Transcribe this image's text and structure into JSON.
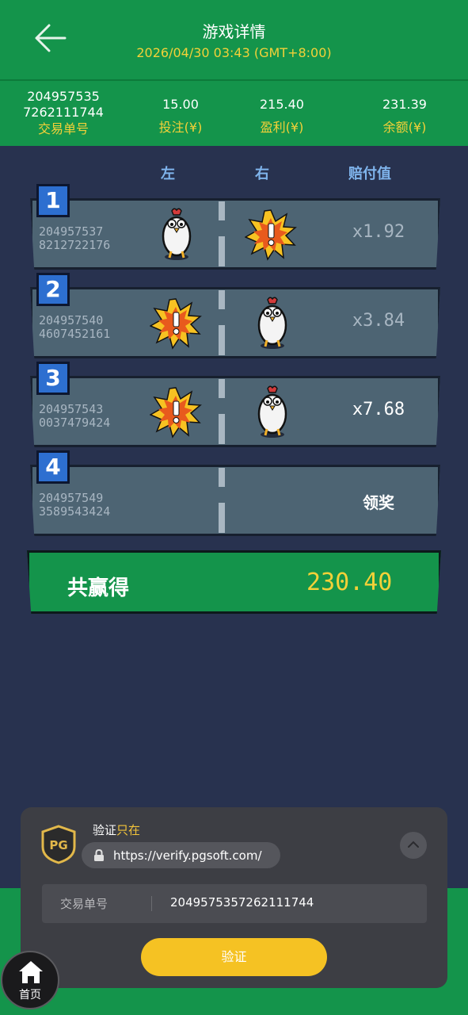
{
  "header": {
    "title": "游戏详情",
    "datetime": "2026/04/30 03:43 (GMT+8:00)"
  },
  "summary": {
    "transaction_id_line1": "204957535",
    "transaction_id_line2": "7262111744",
    "transaction_label": "交易单号",
    "bet_value": "15.00",
    "bet_label": "投注(¥)",
    "profit_value": "215.40",
    "profit_label": "盈利(¥)",
    "balance_value": "231.39",
    "balance_label": "余额(¥)"
  },
  "columns": {
    "left": "左",
    "right": "右",
    "odds": "赔付值"
  },
  "rows": [
    {
      "num": "1",
      "id_line1": "204957537",
      "id_line2": "8212722176",
      "left": "chicken-icon",
      "right": "explosion-icon",
      "odds": "x1.92",
      "odds_color": "#a8b6c2"
    },
    {
      "num": "2",
      "id_line1": "204957540",
      "id_line2": "4607452161",
      "left": "explosion-icon",
      "right": "chicken-icon",
      "odds": "x3.84",
      "odds_color": "#a8b6c2"
    },
    {
      "num": "3",
      "id_line1": "204957543",
      "id_line2": "0037479424",
      "left": "explosion-icon",
      "right": "chicken-icon",
      "odds": "x7.68",
      "odds_color": "#ffffff"
    },
    {
      "num": "4",
      "id_line1": "204957549",
      "id_line2": "3589543424",
      "left": "",
      "right": "",
      "odds": "领奖",
      "odds_color": "#ffffff"
    }
  ],
  "total": {
    "label": "共赢得",
    "value": "230.40"
  },
  "verify_panel": {
    "label_prefix": "验证",
    "label_accent": "只在",
    "url": "https://verify.pgsoft.com/",
    "tx_label": "交易单号",
    "tx_value": "2049575357262111744",
    "button": "验证",
    "logo_text": "PG"
  },
  "nav": {
    "home_label": "首页"
  },
  "colors": {
    "brand_green": "#14944b",
    "accent_yellow": "#f3d138",
    "background": "#28324f",
    "verify_button": "#f5c223"
  }
}
